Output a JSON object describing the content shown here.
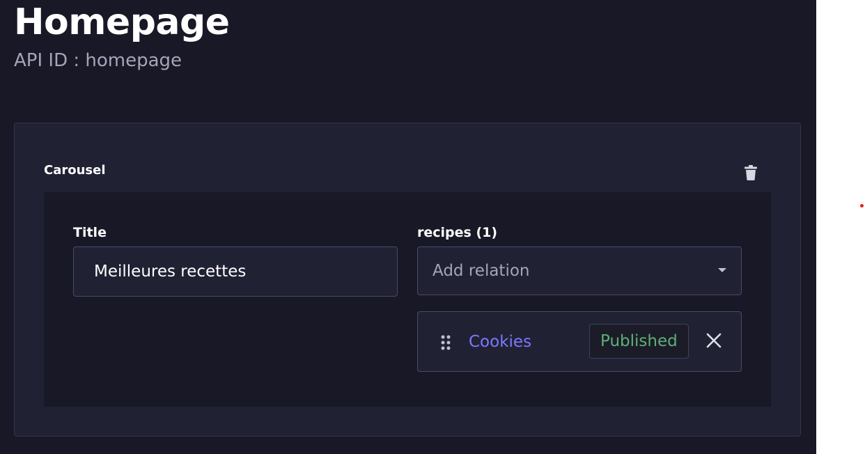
{
  "header": {
    "title": "Homepage",
    "api_id": "API ID : homepage"
  },
  "component": {
    "name": "Carousel",
    "delete_icon": "trash-icon",
    "fields": {
      "title": {
        "label": "Title",
        "value": "Meilleures recettes"
      },
      "recipes": {
        "label": "recipes (1)",
        "placeholder": "Add relation",
        "dropdown_icon": "caret-down-icon",
        "items": [
          {
            "name": "Cookies",
            "status": "Published",
            "drag_icon": "drag-handle-icon",
            "remove_icon": "close-icon"
          }
        ]
      }
    }
  },
  "colors": {
    "background": "#181826",
    "card": "#212134",
    "border": "#4a4a6a",
    "link": "#7b79ff",
    "published": "#5cb176",
    "muted_text": "#a5a5ba"
  }
}
